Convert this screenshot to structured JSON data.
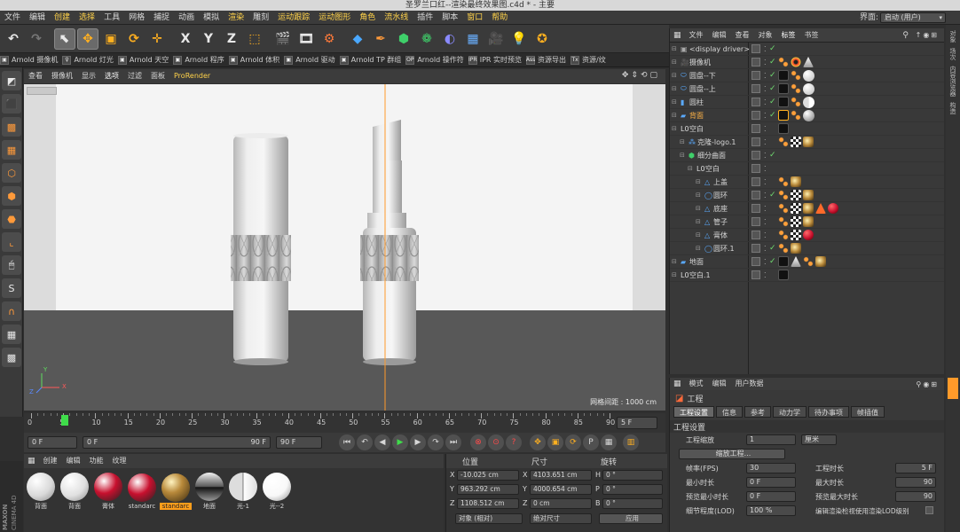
{
  "window": {
    "title": "圣罗兰口红--渲染最终效果图.c4d * - 主要"
  },
  "menubar": {
    "items": [
      {
        "label": "文件",
        "hl": false
      },
      {
        "label": "编辑",
        "hl": false
      },
      {
        "label": "创建",
        "hl": true
      },
      {
        "label": "选择",
        "hl": true
      },
      {
        "label": "工具",
        "hl": false
      },
      {
        "label": "网格",
        "hl": false
      },
      {
        "label": "捕捉",
        "hl": false
      },
      {
        "label": "动画",
        "hl": false
      },
      {
        "label": "模拟",
        "hl": false
      },
      {
        "label": "渲染",
        "hl": true
      },
      {
        "label": "雕刻",
        "hl": false
      },
      {
        "label": "运动跟踪",
        "hl": true
      },
      {
        "label": "运动图形",
        "hl": true
      },
      {
        "label": "角色",
        "hl": true
      },
      {
        "label": "流水线",
        "hl": true
      },
      {
        "label": "插件",
        "hl": false
      },
      {
        "label": "脚本",
        "hl": false
      },
      {
        "label": "窗口",
        "hl": true
      },
      {
        "label": "帮助",
        "hl": true
      }
    ],
    "layout_label": "界面:",
    "layout_value": "启动 (用户)"
  },
  "toolbar": {
    "buttons": [
      {
        "name": "undo-button",
        "glyph": "↶",
        "color": "#e8e8e8",
        "sel": false
      },
      {
        "name": "redo-button",
        "glyph": "↷",
        "color": "#777777",
        "sel": false
      },
      {
        "name": "sep"
      },
      {
        "name": "live-select-button",
        "glyph": "⬉",
        "color": "#e8e8e8",
        "sel": true
      },
      {
        "name": "move-button",
        "glyph": "✥",
        "color": "#ffb020",
        "sel": true
      },
      {
        "name": "scale-button",
        "glyph": "▣",
        "color": "#ffb020",
        "sel": false
      },
      {
        "name": "rotate-button",
        "glyph": "⟳",
        "color": "#ffb020",
        "sel": false
      },
      {
        "name": "recent-tool-button",
        "glyph": "✛",
        "color": "#ffb020",
        "sel": false
      },
      {
        "name": "sep"
      },
      {
        "name": "x-axis-button",
        "glyph": "X",
        "color": "#e8e8e8",
        "sel": false
      },
      {
        "name": "y-axis-button",
        "glyph": "Y",
        "color": "#e8e8e8",
        "sel": false
      },
      {
        "name": "z-axis-button",
        "glyph": "Z",
        "color": "#e8e8e8",
        "sel": false
      },
      {
        "name": "coordinate-system-button",
        "glyph": "⬚",
        "color": "#ffb020",
        "sel": false
      },
      {
        "name": "sep"
      },
      {
        "name": "render-view-button",
        "glyph": "🎬",
        "color": "#e8e8e8",
        "sel": false
      },
      {
        "name": "render-picture-viewer-button",
        "glyph": "🎞",
        "color": "#e8e8e8",
        "sel": false
      },
      {
        "name": "render-settings-button",
        "glyph": "⚙",
        "color": "#ff7a3a",
        "sel": false
      },
      {
        "name": "sep"
      },
      {
        "name": "cube-button",
        "glyph": "◆",
        "color": "#4aa8ff",
        "sel": false
      },
      {
        "name": "pen-button",
        "glyph": "✒",
        "color": "#ff9a3a",
        "sel": false
      },
      {
        "name": "subdivision-button",
        "glyph": "⬢",
        "color": "#3fcf6a",
        "sel": false
      },
      {
        "name": "array-button",
        "glyph": "❁",
        "color": "#3fcf6a",
        "sel": false
      },
      {
        "name": "deformer-button",
        "glyph": "◐",
        "color": "#8a8aff",
        "sel": false
      },
      {
        "name": "floor-button",
        "glyph": "▦",
        "color": "#6ab0ff",
        "sel": false
      },
      {
        "name": "camera-button",
        "glyph": "🎥",
        "color": "#e8e8e8",
        "sel": false
      },
      {
        "name": "light-button",
        "glyph": "💡",
        "color": "#e8e8e8",
        "sel": false
      },
      {
        "name": "star-button",
        "glyph": "✪",
        "color": "#ffb020",
        "sel": false
      }
    ]
  },
  "pluginbar": {
    "items": [
      {
        "icon": "▣",
        "label": "Arnold 摄像机"
      },
      {
        "icon": "♀",
        "label": "Arnold 灯光"
      },
      {
        "icon": "▣",
        "label": "Arnold 天空"
      },
      {
        "icon": "▣",
        "label": "Arnold 程序"
      },
      {
        "icon": "▣",
        "label": "Arnold 体积"
      },
      {
        "icon": "▣",
        "label": "Arnold 驱动"
      },
      {
        "icon": "▣",
        "label": "Arnold TP 群组"
      },
      {
        "icon": "OP",
        "label": "Arnold 操作符"
      },
      {
        "icon": "IPR",
        "label": "IPR 实时预览"
      },
      {
        "icon": "Ass",
        "label": "资源导出"
      },
      {
        "icon": "Tx",
        "label": "资源/纹"
      }
    ]
  },
  "lefttools": {
    "items": [
      {
        "name": "make-editable-icon",
        "glyph": "◩",
        "color": "#e8e8e8"
      },
      {
        "name": "model-mode-icon",
        "glyph": "⬛",
        "color": "#ff9a3a"
      },
      {
        "name": "texture-mode-icon",
        "glyph": "▩",
        "color": "#ff9a3a"
      },
      {
        "name": "workplane-icon",
        "glyph": "▦",
        "color": "#ff9a3a"
      },
      {
        "name": "points-mode-icon",
        "glyph": "⬡",
        "color": "#ff9a3a"
      },
      {
        "name": "edges-mode-icon",
        "glyph": "⬢",
        "color": "#ff9a3a"
      },
      {
        "name": "polygons-mode-icon",
        "glyph": "⬣",
        "color": "#ff9a3a"
      },
      {
        "name": "axis-mode-icon",
        "glyph": "⌞",
        "color": "#ff9a3a"
      },
      {
        "name": "tweak-mode-icon",
        "glyph": "🖱",
        "color": "#e8e8e8"
      },
      {
        "name": "snap-icon",
        "glyph": "S",
        "color": "#e8e8e8"
      },
      {
        "name": "magnet-icon",
        "glyph": "∩",
        "color": "#ff9a3a"
      },
      {
        "name": "lock-workplane-icon",
        "glyph": "▦",
        "color": "#e8e8e8"
      },
      {
        "name": "grid-icon",
        "glyph": "▩",
        "color": "#e8e8e8"
      }
    ]
  },
  "viewport": {
    "menu": [
      {
        "label": "查看",
        "cls": ""
      },
      {
        "label": "摄像机",
        "cls": ""
      },
      {
        "label": "显示",
        "cls": ""
      },
      {
        "label": "选项",
        "cls": "hl"
      },
      {
        "label": "过滤",
        "cls": ""
      },
      {
        "label": "面板",
        "cls": ""
      },
      {
        "label": "ProRender",
        "cls": "pr"
      }
    ],
    "grid_note": "网格间距 : 1000 cm",
    "axis_y": "Y",
    "axis_z": "Z",
    "axis_x": "X"
  },
  "timeline": {
    "ticks": [
      "0",
      "5",
      "10",
      "15",
      "20",
      "25",
      "30",
      "35",
      "40",
      "45",
      "50",
      "55",
      "60",
      "65",
      "70",
      "75",
      "80",
      "85",
      "90"
    ],
    "current_frame": "5 F"
  },
  "playbar": {
    "start": "0 F",
    "range_start": "0 F",
    "range_end": "90 F",
    "end": "90 F"
  },
  "materials": {
    "menu": [
      "创建",
      "编辑",
      "功能",
      "纹理"
    ],
    "items": [
      {
        "label": "背面",
        "color": "#d9d9d9",
        "type": "matte",
        "sel": false
      },
      {
        "label": "背面",
        "color": "#e0e0e0",
        "type": "matte",
        "sel": false
      },
      {
        "label": "膏体",
        "color": "#c8102e",
        "type": "glossy",
        "sel": false
      },
      {
        "label": "standarc",
        "color": "#c8102e",
        "type": "glossy",
        "sel": false
      },
      {
        "label": "standarc",
        "color": "#b8893a",
        "type": "metal",
        "sel": true
      },
      {
        "label": "地面",
        "color": "#888888",
        "type": "chrome",
        "sel": false
      },
      {
        "label": "光-1",
        "color": "#f2f2f2",
        "type": "split",
        "sel": false
      },
      {
        "label": "光--2",
        "color": "#f8f8f8",
        "type": "matte",
        "sel": false
      }
    ]
  },
  "coords": {
    "headers": [
      "位置",
      "尺寸",
      "旋转"
    ],
    "rows": [
      {
        "axis": "X",
        "pos": "-10.025 cm",
        "size_axis": "X",
        "size": "4103.651 cm",
        "rot_axis": "H",
        "rot": "0 °"
      },
      {
        "axis": "Y",
        "pos": "963.292 cm",
        "size_axis": "Y",
        "size": "4000.654 cm",
        "rot_axis": "P",
        "rot": "0 °"
      },
      {
        "axis": "Z",
        "pos": "1108.512 cm",
        "size_axis": "Z",
        "size": "0 cm",
        "rot_axis": "B",
        "rot": "0 °"
      }
    ],
    "mode": "对象 (相对)",
    "size_mode": "绝对尺寸",
    "apply": "应用"
  },
  "objects": {
    "tabs": [
      {
        "label": "文件",
        "sel": false
      },
      {
        "label": "编辑",
        "sel": false
      },
      {
        "label": "查看",
        "sel": false
      },
      {
        "label": "对象",
        "sel": false
      },
      {
        "label": "标签",
        "sel": true
      },
      {
        "label": "书签",
        "sel": false
      }
    ],
    "rows": [
      {
        "name": "<display driver>",
        "indent": 0,
        "icon": "▣",
        "icolor": "#aaaaaa",
        "hl": false,
        "tick": true,
        "tags": []
      },
      {
        "name": "摄像机",
        "indent": 0,
        "icon": "🎥",
        "icolor": "#dddddd",
        "hl": false,
        "tick": true,
        "tags": [
          "orange-dots",
          "red-target",
          "cone"
        ]
      },
      {
        "name": "圆盘--下",
        "indent": 0,
        "icon": "⬭",
        "icolor": "#5aaaff",
        "hl": false,
        "tick": true,
        "tags": [
          "black",
          "orange-dots",
          "white-ball"
        ]
      },
      {
        "name": "圆盘--上",
        "indent": 0,
        "icon": "⬭",
        "icolor": "#5aaaff",
        "hl": false,
        "tick": true,
        "tags": [
          "black",
          "orange-dots",
          "white-ball"
        ]
      },
      {
        "name": "圆柱",
        "indent": 0,
        "icon": "▮",
        "icolor": "#5aaaff",
        "hl": false,
        "tick": true,
        "tags": [
          "black",
          "orange-dots",
          "split-ball"
        ]
      },
      {
        "name": "背面",
        "indent": 0,
        "icon": "▰",
        "icolor": "#5aaaff",
        "hl": true,
        "tick": true,
        "tags": [
          "selected-black",
          "orange-dots",
          "grey-ball"
        ]
      },
      {
        "name": "空白",
        "indent": 0,
        "icon": "L0",
        "icolor": "#dddddd",
        "hl": false,
        "tick": false,
        "tags": [
          "black"
        ]
      },
      {
        "name": "克隆-logo.1",
        "indent": 1,
        "icon": "⁂",
        "icolor": "#5aaaff",
        "hl": false,
        "tick": false,
        "tags": [
          "orange-dots",
          "checker",
          "gold-ball"
        ]
      },
      {
        "name": "细分曲面",
        "indent": 1,
        "icon": "⬢",
        "icolor": "#3fcf6a",
        "hl": false,
        "tick": true,
        "tags": []
      },
      {
        "name": "空白",
        "indent": 2,
        "icon": "L0",
        "icolor": "#dddddd",
        "hl": false,
        "tick": false,
        "tags": []
      },
      {
        "name": "上盖",
        "indent": 3,
        "icon": "△",
        "icolor": "#5aaaff",
        "hl": false,
        "tick": false,
        "tags": [
          "orange-dots",
          "gold-ball"
        ]
      },
      {
        "name": "圆环",
        "indent": 3,
        "icon": "◯",
        "icolor": "#5aaaff",
        "hl": false,
        "tick": true,
        "tags": [
          "orange-dots",
          "checker",
          "gold-ball"
        ]
      },
      {
        "name": "底座",
        "indent": 3,
        "icon": "△",
        "icolor": "#5aaaff",
        "hl": false,
        "tick": false,
        "tags": [
          "orange-dots",
          "checker",
          "gold-ball",
          "orange-triangle",
          "red-ball"
        ]
      },
      {
        "name": "管子",
        "indent": 3,
        "icon": "△",
        "icolor": "#5aaaff",
        "hl": false,
        "tick": false,
        "tags": [
          "orange-dots",
          "checker",
          "gold-ball"
        ]
      },
      {
        "name": "膏体",
        "indent": 3,
        "icon": "△",
        "icolor": "#5aaaff",
        "hl": false,
        "tick": false,
        "tags": [
          "orange-dots",
          "checker",
          "red-ball"
        ]
      },
      {
        "name": "圆环.1",
        "indent": 3,
        "icon": "◯",
        "icolor": "#5aaaff",
        "hl": false,
        "tick": true,
        "tags": [
          "orange-dots",
          "gold-ball"
        ]
      },
      {
        "name": "地面",
        "indent": 0,
        "icon": "▰",
        "icolor": "#5aaaff",
        "hl": false,
        "tick": true,
        "tags": [
          "black",
          "cone",
          "orange-dots",
          "gold-ball"
        ]
      },
      {
        "name": "空白.1",
        "indent": 0,
        "icon": "L0",
        "icolor": "#dddddd",
        "hl": false,
        "tick": false,
        "tags": [
          "black"
        ]
      }
    ]
  },
  "right_strip": {
    "labels": [
      "对象",
      "场次",
      "内容浏览器",
      "构造"
    ]
  },
  "attributes": {
    "menu": [
      "模式",
      "编辑",
      "用户数据"
    ],
    "title": "工程",
    "tabs": [
      {
        "label": "工程设置",
        "sel": true
      },
      {
        "label": "信息",
        "sel": false
      },
      {
        "label": "参考",
        "sel": false
      },
      {
        "label": "动力学",
        "sel": false
      },
      {
        "label": "待办事项",
        "sel": false
      },
      {
        "label": "帧插值",
        "sel": false
      }
    ],
    "section": "工程设置",
    "scale_label": "工程缩放",
    "scale_value": "1",
    "scale_unit": "厘米",
    "scale_button": "缩放工程...",
    "fps_label": "帧率(FPS)",
    "fps": "30",
    "project_time_label": "工程时长",
    "project_time": "5 F",
    "min_time_label": "最小时长",
    "min_time": "0 F",
    "max_time_label": "最大时长",
    "max_time": "90",
    "preview_min_label": "预览最小时长",
    "preview_min": "0 F",
    "preview_max_label": "预览最大时长",
    "preview_max": "90",
    "lod_label": "细节程度(LOD)",
    "lod": "100 %",
    "lod_note": "编辑渲染检视使用渲染LOD级别"
  },
  "brand": {
    "line1": "MAXON",
    "line2": "CINEMA 4D"
  }
}
